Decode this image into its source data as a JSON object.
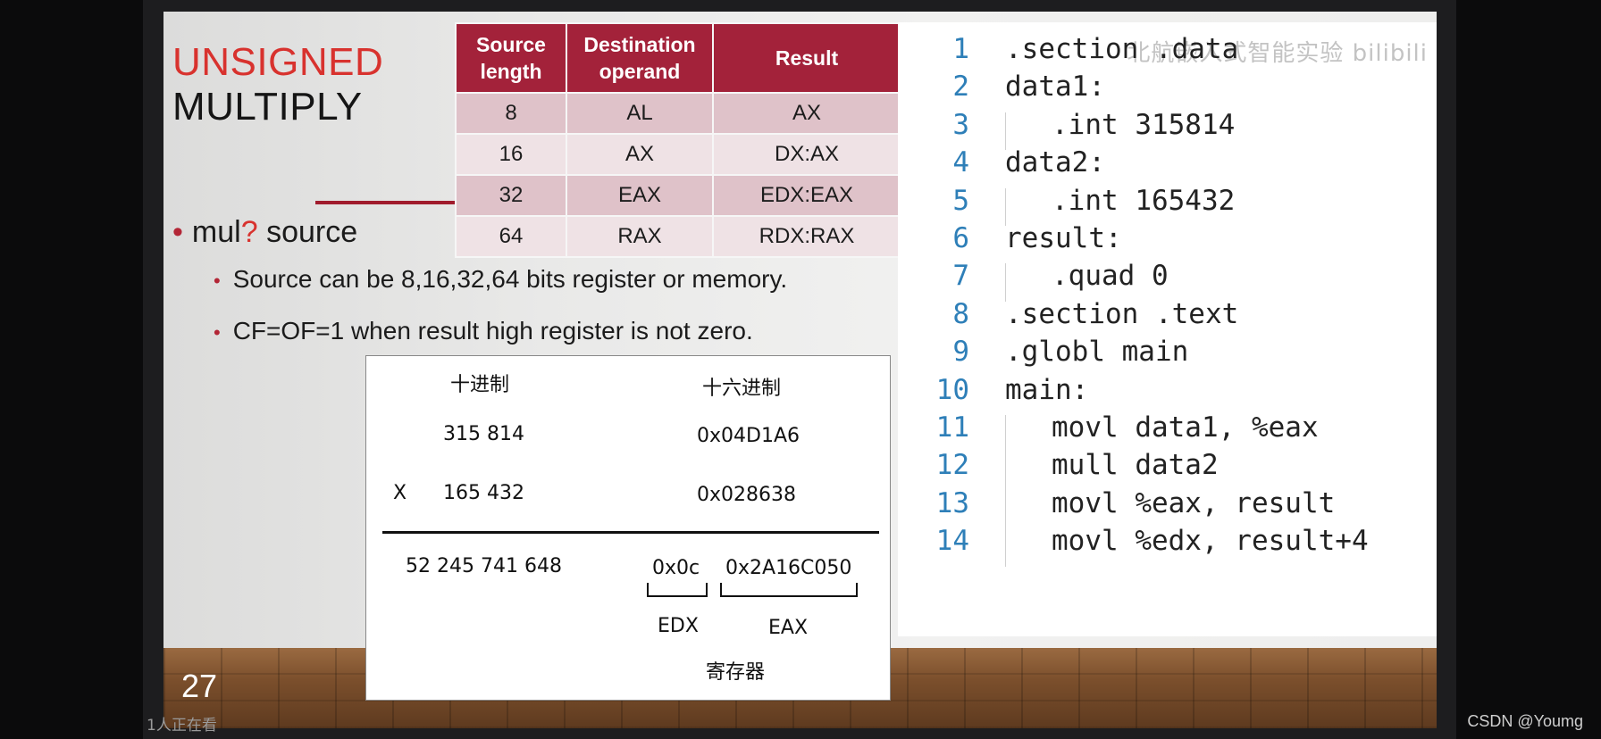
{
  "slide": {
    "title_line1": "UNSIGNED",
    "title_line2": "MULTIPLY",
    "page_number": "27",
    "bullet_main_prefix": "mul",
    "bullet_main_q": "?",
    "bullet_main_suffix": " source",
    "sub_bullets": [
      "Source can be 8,16,32,64 bits register or memory.",
      "CF=OF=1 when result high register is not zero."
    ]
  },
  "table": {
    "headers": [
      "Source\nlength",
      "Destination\noperand",
      "Result"
    ],
    "rows": [
      [
        "8",
        "AL",
        "AX"
      ],
      [
        "16",
        "AX",
        "DX:AX"
      ],
      [
        "32",
        "EAX",
        "EDX:EAX"
      ],
      [
        "64",
        "RAX",
        "RDX:RAX"
      ]
    ]
  },
  "scan": {
    "col_decimal": "十进制",
    "col_hex": "十六进制",
    "dec1": "315 814",
    "hex1": "0x04D1A6",
    "times": "X",
    "dec2": "165 432",
    "hex2": "0x028638",
    "dec_result": "52 245 741 648",
    "hex_high": "0x0c",
    "hex_low": "0x2A16C050",
    "reg_high": "EDX",
    "reg_low": "EAX",
    "registers_label": "寄存器"
  },
  "code": {
    "watermark": "北航嵌入式智能实验 bilibili",
    "lines": [
      {
        "n": "1",
        "text": ".section .data",
        "indent": 0
      },
      {
        "n": "2",
        "text": "data1:",
        "indent": 0
      },
      {
        "n": "3",
        "text": ".int 315814",
        "indent": 1
      },
      {
        "n": "4",
        "text": "data2:",
        "indent": 0
      },
      {
        "n": "5",
        "text": ".int 165432",
        "indent": 1
      },
      {
        "n": "6",
        "text": "result:",
        "indent": 0
      },
      {
        "n": "7",
        "text": ".quad 0",
        "indent": 1
      },
      {
        "n": "8",
        "text": ".section .text",
        "indent": 0
      },
      {
        "n": "9",
        "text": ".globl main",
        "indent": 0
      },
      {
        "n": "10",
        "text": "main:",
        "indent": 0
      },
      {
        "n": "11",
        "text": "movl data1, %eax",
        "indent": 1
      },
      {
        "n": "12",
        "text": "mull data2",
        "indent": 1
      },
      {
        "n": "13",
        "text": "movl %eax, result",
        "indent": 1
      },
      {
        "n": "14",
        "text": "movl %edx, result+4",
        "indent": 1
      }
    ]
  },
  "footer": {
    "viewers": "1人正在看",
    "credit": "CSDN @Youmg"
  }
}
